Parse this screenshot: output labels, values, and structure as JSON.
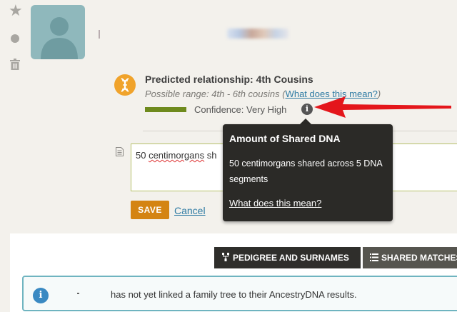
{
  "match": {
    "relationship_title": "Predicted relationship: 4th Cousins",
    "possible_range": "Possible range: 4th - 6th cousins (",
    "range_link": "What does this mean?",
    "range_close": ")",
    "confidence": "Confidence: Very High",
    "confidence_color": "#6e8a1d"
  },
  "note": {
    "text_prefix": "50 ",
    "text_misspelled": "centimorgans",
    "text_suffix": " sh"
  },
  "actions": {
    "save_label": "SAVE",
    "cancel_label": "Cancel"
  },
  "tooltip": {
    "title": "Amount of Shared DNA",
    "body": "50 centimorgans shared across 5 DNA segments",
    "link": "What does this mean?"
  },
  "tabs": [
    {
      "label": "PEDIGREE AND SURNAMES",
      "icon": "family-tree-icon"
    },
    {
      "label": "SHARED MATCHES",
      "icon": "list-icon"
    }
  ],
  "alert": {
    "text": "has not yet linked a family tree to their AncestryDNA results."
  },
  "colors": {
    "accent_orange": "#d48412",
    "link_blue": "#2d7aa3",
    "arrow_red": "#e4161b"
  }
}
